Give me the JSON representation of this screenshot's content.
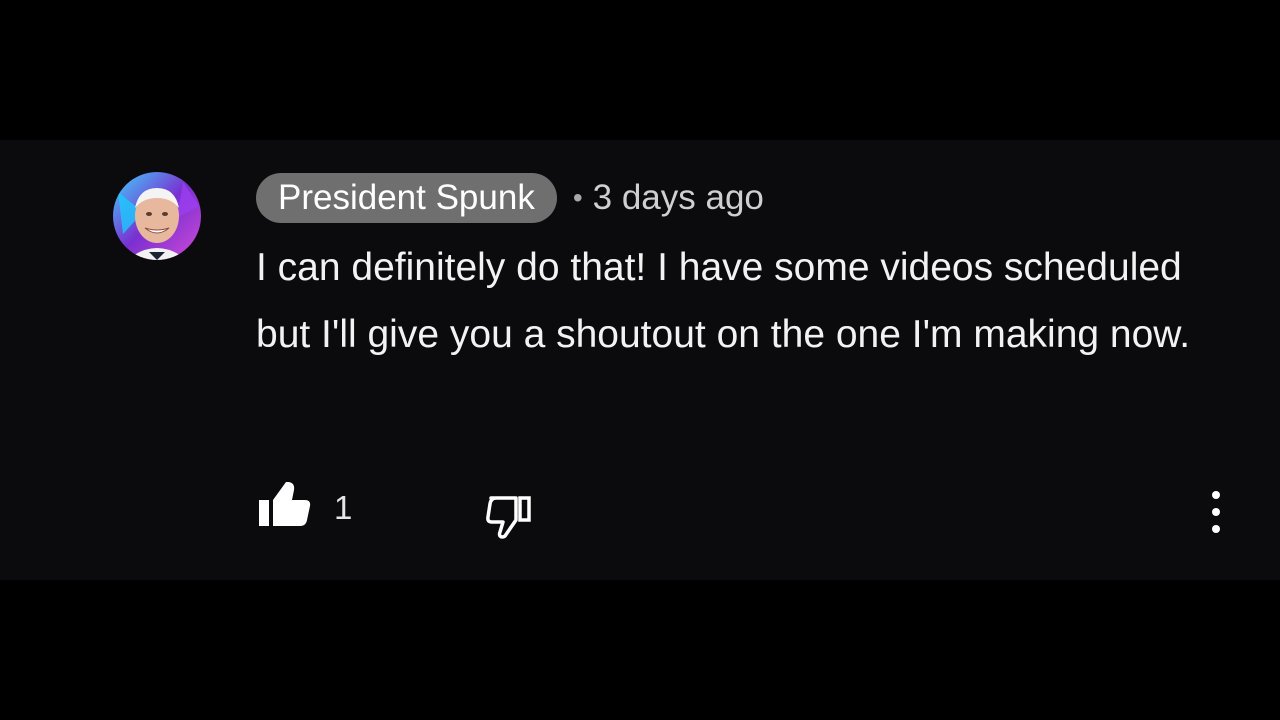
{
  "comment": {
    "author": "President Spunk",
    "separator": "•",
    "timestamp": "3 days ago",
    "text": "I can definitely do that! I have some videos scheduled but I'll give you a shoutout on the one I'm making now.",
    "likes": "1",
    "icons": {
      "avatar": "avatar-icon",
      "like": "thumbs-up-icon",
      "dislike": "thumbs-down-icon",
      "more": "more-vertical-icon"
    }
  },
  "colors": {
    "background": "#000000",
    "card": "#0b0b0d",
    "chip": "#6f6f6f",
    "text": "#f2f2f2"
  }
}
